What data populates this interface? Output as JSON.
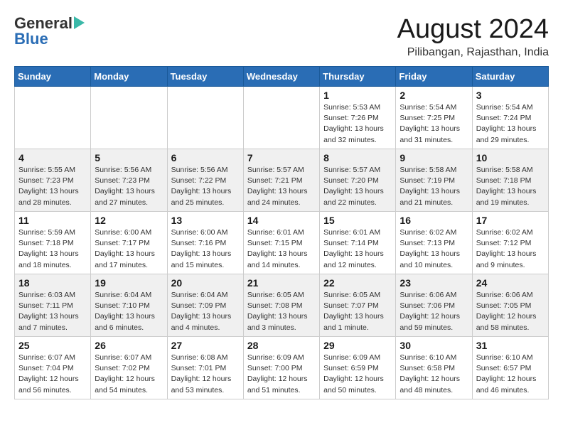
{
  "logo": {
    "general": "General",
    "blue": "Blue"
  },
  "title": "August 2024",
  "location": "Pilibangan, Rajasthan, India",
  "weekdays": [
    "Sunday",
    "Monday",
    "Tuesday",
    "Wednesday",
    "Thursday",
    "Friday",
    "Saturday"
  ],
  "weeks": [
    [
      {
        "day": "",
        "detail": ""
      },
      {
        "day": "",
        "detail": ""
      },
      {
        "day": "",
        "detail": ""
      },
      {
        "day": "",
        "detail": ""
      },
      {
        "day": "1",
        "detail": "Sunrise: 5:53 AM\nSunset: 7:26 PM\nDaylight: 13 hours\nand 32 minutes."
      },
      {
        "day": "2",
        "detail": "Sunrise: 5:54 AM\nSunset: 7:25 PM\nDaylight: 13 hours\nand 31 minutes."
      },
      {
        "day": "3",
        "detail": "Sunrise: 5:54 AM\nSunset: 7:24 PM\nDaylight: 13 hours\nand 29 minutes."
      }
    ],
    [
      {
        "day": "4",
        "detail": "Sunrise: 5:55 AM\nSunset: 7:23 PM\nDaylight: 13 hours\nand 28 minutes."
      },
      {
        "day": "5",
        "detail": "Sunrise: 5:56 AM\nSunset: 7:23 PM\nDaylight: 13 hours\nand 27 minutes."
      },
      {
        "day": "6",
        "detail": "Sunrise: 5:56 AM\nSunset: 7:22 PM\nDaylight: 13 hours\nand 25 minutes."
      },
      {
        "day": "7",
        "detail": "Sunrise: 5:57 AM\nSunset: 7:21 PM\nDaylight: 13 hours\nand 24 minutes."
      },
      {
        "day": "8",
        "detail": "Sunrise: 5:57 AM\nSunset: 7:20 PM\nDaylight: 13 hours\nand 22 minutes."
      },
      {
        "day": "9",
        "detail": "Sunrise: 5:58 AM\nSunset: 7:19 PM\nDaylight: 13 hours\nand 21 minutes."
      },
      {
        "day": "10",
        "detail": "Sunrise: 5:58 AM\nSunset: 7:18 PM\nDaylight: 13 hours\nand 19 minutes."
      }
    ],
    [
      {
        "day": "11",
        "detail": "Sunrise: 5:59 AM\nSunset: 7:18 PM\nDaylight: 13 hours\nand 18 minutes."
      },
      {
        "day": "12",
        "detail": "Sunrise: 6:00 AM\nSunset: 7:17 PM\nDaylight: 13 hours\nand 17 minutes."
      },
      {
        "day": "13",
        "detail": "Sunrise: 6:00 AM\nSunset: 7:16 PM\nDaylight: 13 hours\nand 15 minutes."
      },
      {
        "day": "14",
        "detail": "Sunrise: 6:01 AM\nSunset: 7:15 PM\nDaylight: 13 hours\nand 14 minutes."
      },
      {
        "day": "15",
        "detail": "Sunrise: 6:01 AM\nSunset: 7:14 PM\nDaylight: 13 hours\nand 12 minutes."
      },
      {
        "day": "16",
        "detail": "Sunrise: 6:02 AM\nSunset: 7:13 PM\nDaylight: 13 hours\nand 10 minutes."
      },
      {
        "day": "17",
        "detail": "Sunrise: 6:02 AM\nSunset: 7:12 PM\nDaylight: 13 hours\nand 9 minutes."
      }
    ],
    [
      {
        "day": "18",
        "detail": "Sunrise: 6:03 AM\nSunset: 7:11 PM\nDaylight: 13 hours\nand 7 minutes."
      },
      {
        "day": "19",
        "detail": "Sunrise: 6:04 AM\nSunset: 7:10 PM\nDaylight: 13 hours\nand 6 minutes."
      },
      {
        "day": "20",
        "detail": "Sunrise: 6:04 AM\nSunset: 7:09 PM\nDaylight: 13 hours\nand 4 minutes."
      },
      {
        "day": "21",
        "detail": "Sunrise: 6:05 AM\nSunset: 7:08 PM\nDaylight: 13 hours\nand 3 minutes."
      },
      {
        "day": "22",
        "detail": "Sunrise: 6:05 AM\nSunset: 7:07 PM\nDaylight: 13 hours\nand 1 minute."
      },
      {
        "day": "23",
        "detail": "Sunrise: 6:06 AM\nSunset: 7:06 PM\nDaylight: 12 hours\nand 59 minutes."
      },
      {
        "day": "24",
        "detail": "Sunrise: 6:06 AM\nSunset: 7:05 PM\nDaylight: 12 hours\nand 58 minutes."
      }
    ],
    [
      {
        "day": "25",
        "detail": "Sunrise: 6:07 AM\nSunset: 7:04 PM\nDaylight: 12 hours\nand 56 minutes."
      },
      {
        "day": "26",
        "detail": "Sunrise: 6:07 AM\nSunset: 7:02 PM\nDaylight: 12 hours\nand 54 minutes."
      },
      {
        "day": "27",
        "detail": "Sunrise: 6:08 AM\nSunset: 7:01 PM\nDaylight: 12 hours\nand 53 minutes."
      },
      {
        "day": "28",
        "detail": "Sunrise: 6:09 AM\nSunset: 7:00 PM\nDaylight: 12 hours\nand 51 minutes."
      },
      {
        "day": "29",
        "detail": "Sunrise: 6:09 AM\nSunset: 6:59 PM\nDaylight: 12 hours\nand 50 minutes."
      },
      {
        "day": "30",
        "detail": "Sunrise: 6:10 AM\nSunset: 6:58 PM\nDaylight: 12 hours\nand 48 minutes."
      },
      {
        "day": "31",
        "detail": "Sunrise: 6:10 AM\nSunset: 6:57 PM\nDaylight: 12 hours\nand 46 minutes."
      }
    ]
  ]
}
